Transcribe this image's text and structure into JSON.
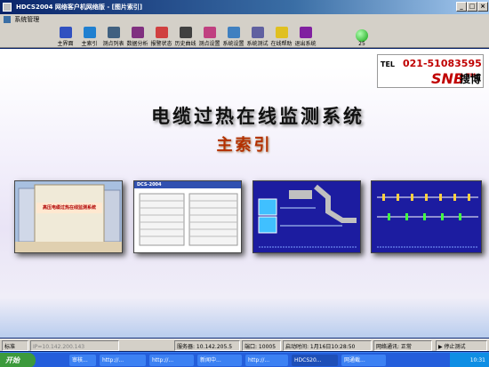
{
  "window": {
    "title": "HDCS2004 网络客户机网络版 - [图片索引]"
  },
  "menubar": {
    "items": [
      "系统管理"
    ]
  },
  "toolbar": {
    "buttons": [
      {
        "label": "主界面",
        "icon": "home-icon",
        "color": "#3050c0"
      },
      {
        "label": "主索引",
        "icon": "index-icon",
        "color": "#2080d0"
      },
      {
        "label": "测点列表",
        "icon": "list-icon",
        "color": "#406080"
      },
      {
        "label": "数据分析",
        "icon": "analysis-icon",
        "color": "#803080"
      },
      {
        "label": "报警状态",
        "icon": "alarm-icon",
        "color": "#d04040"
      },
      {
        "label": "历史曲线",
        "icon": "history-curve-icon",
        "color": "#404040"
      },
      {
        "label": "测点设置",
        "icon": "point-settings-icon",
        "color": "#c04080"
      },
      {
        "label": "系统设置",
        "icon": "system-settings-icon",
        "color": "#4080c0"
      },
      {
        "label": "系统测试",
        "icon": "system-test-icon",
        "color": "#6060a0"
      },
      {
        "label": "在线帮助",
        "icon": "help-icon",
        "color": "#e0c020"
      },
      {
        "label": "退出系统",
        "icon": "exit-icon",
        "color": "#8020a0"
      }
    ],
    "status_count": "25"
  },
  "logo": {
    "tel": "TEL",
    "phone": "021-51083595",
    "brand": "SNB™",
    "brand_cn": "搜博"
  },
  "main": {
    "title": "电缆过热在线监测系统",
    "subtitle": "主索引"
  },
  "thumbnails": [
    {
      "name": "thumb-welcome",
      "caption": "高压电缆过热在线监测系统"
    },
    {
      "name": "thumb-table",
      "caption": "DCS-2004"
    },
    {
      "name": "thumb-diagram-1",
      "caption": ""
    },
    {
      "name": "thumb-diagram-2",
      "caption": ""
    }
  ],
  "statusbar": {
    "mode": "标准",
    "ip": "IP=10.142.200.143",
    "server": "服务器: 10.142.205.5",
    "port": "端口: 10005",
    "start_time": "启动时间: 1月16日10:28:50",
    "network": "网络通讯: 正常",
    "stop_test": "停止测试"
  },
  "taskbar": {
    "start_label": "开始",
    "tasks": [
      "审核...",
      "http://...",
      "http://...",
      "新闻中...",
      "http://...",
      "HDCS20...",
      "网通截..."
    ],
    "clock": "10:31"
  }
}
